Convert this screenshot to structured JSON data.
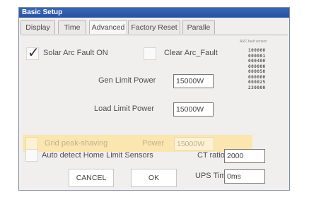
{
  "window": {
    "title": "Basic Setup"
  },
  "tabs": [
    {
      "label": "Display",
      "active": false
    },
    {
      "label": "Time",
      "active": false
    },
    {
      "label": "Advanced",
      "active": true
    },
    {
      "label": "Factory Reset",
      "active": false
    },
    {
      "label": "Paralle",
      "active": false
    }
  ],
  "advanced": {
    "solar_arc_fault": {
      "label": "Solar Arc Fault ON",
      "checked": true
    },
    "clear_arc_fault": {
      "label": "Clear Arc_Fault",
      "checked": false
    },
    "gen_limit_power": {
      "label": "Gen Limit Power",
      "value": "15000W"
    },
    "load_limit_power": {
      "label": "Load Limit Power",
      "value": "15000W"
    },
    "grid_peak_shaving": {
      "label": "Grid peak-shaving",
      "checked": false,
      "power_label": "Power",
      "power_value": "15000W"
    },
    "auto_detect": {
      "label": "Auto detect Home Limit Sensors",
      "checked": false
    },
    "ct_ratio": {
      "label": "CT ratio",
      "value": "2000"
    },
    "ups_time": {
      "label": "UPS Time",
      "value": "0ms"
    },
    "cancel_label": "CANCEL",
    "ok_label": "OK"
  },
  "version_info": {
    "header": "ARC fault version",
    "lines": [
      "100000",
      "000001",
      "000400",
      "000000",
      "000050",
      "000000",
      "000025",
      "230000"
    ]
  },
  "colors": {
    "title_bar": "#2552a3",
    "highlight": "#fbe6b0"
  }
}
